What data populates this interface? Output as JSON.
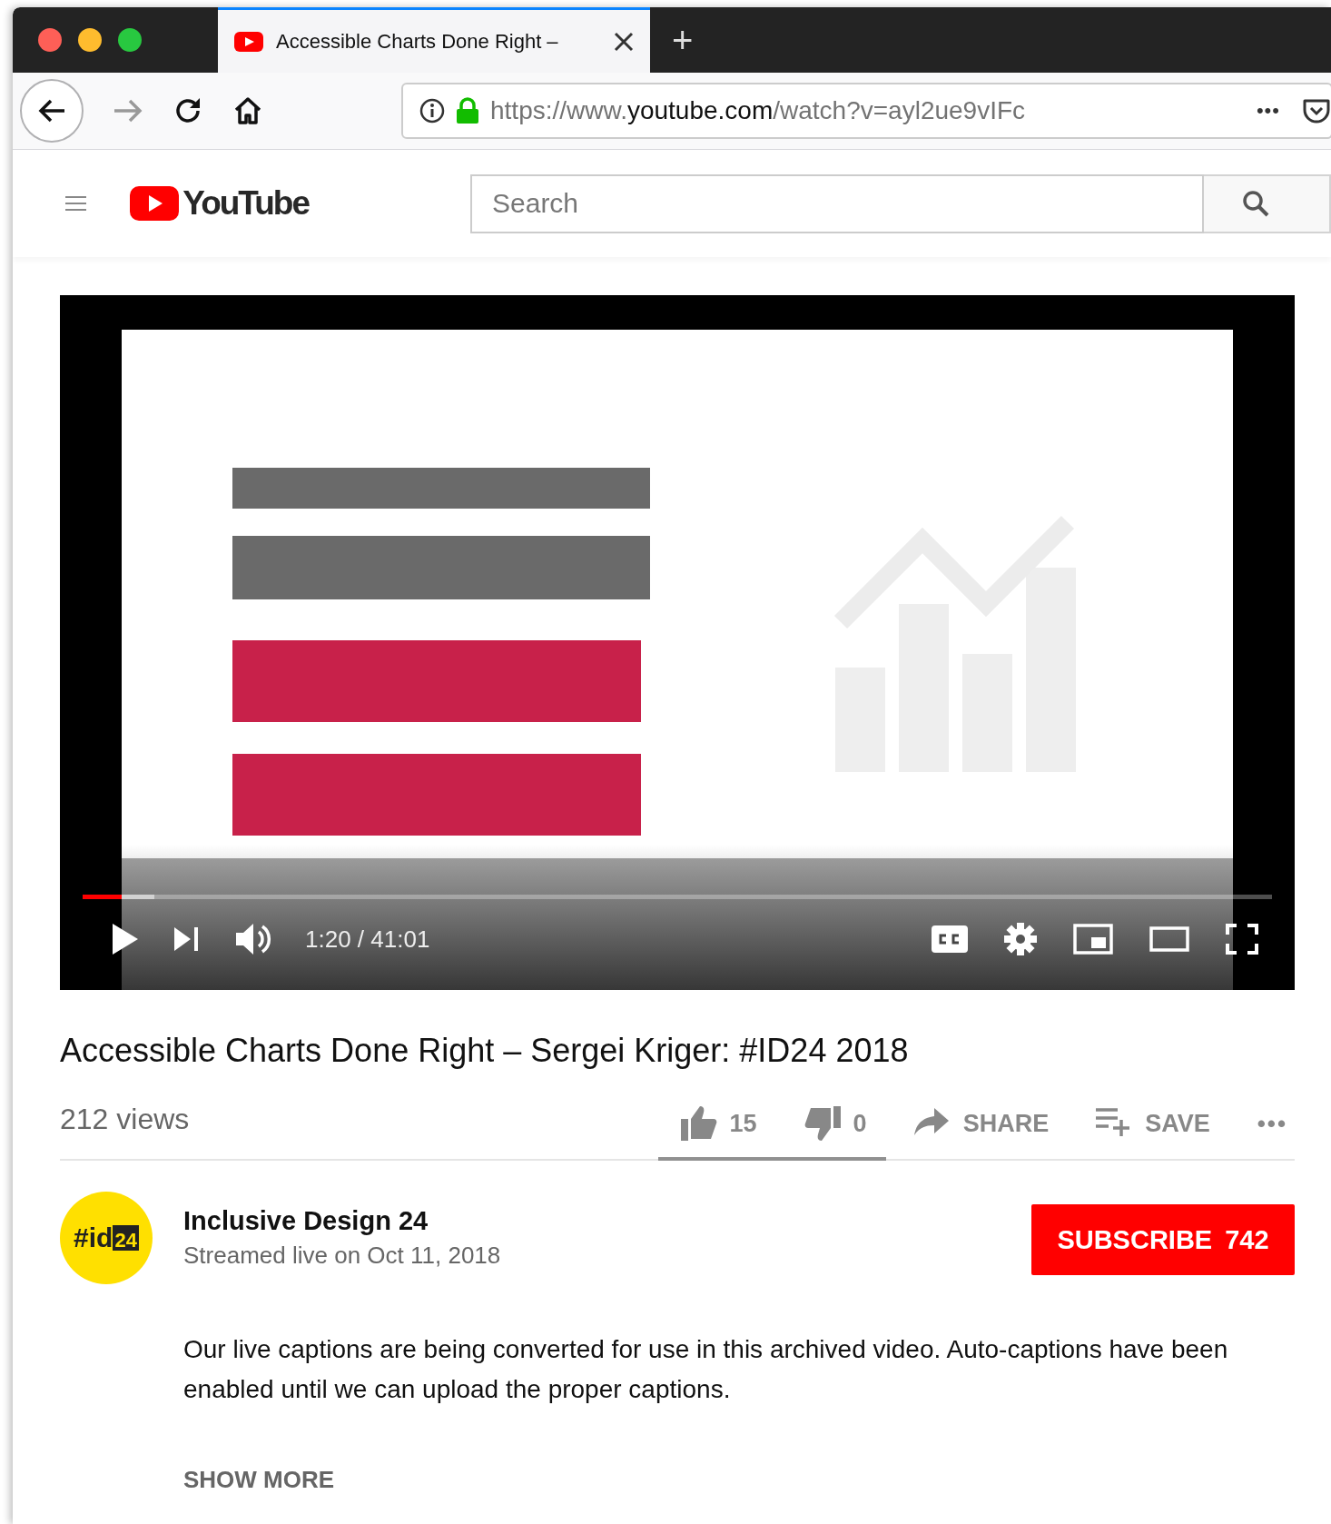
{
  "browser": {
    "tab": {
      "title": "Accessible Charts Done Right –",
      "selected": true
    },
    "new_tab": "+",
    "url": {
      "scheme": "https://www.",
      "domain": "youtube.com",
      "path": "/watch?v=ayl2ue9vIFc"
    },
    "menu": "•••"
  },
  "header": {
    "logo": "YouTube",
    "search": {
      "placeholder": "Search"
    }
  },
  "player": {
    "progress": {
      "level": 0.033
    },
    "time": "1:20 / 41:01",
    "playing": false
  },
  "video": {
    "title": "Accessible Charts Done Right – Sergei Kriger: #ID24 2018",
    "views": "212 views",
    "actions": [
      {
        "kind": "like",
        "label": "15"
      },
      {
        "kind": "dislike",
        "label": "0"
      },
      {
        "kind": "share",
        "label": "SHARE"
      },
      {
        "kind": "save",
        "label": "SAVE"
      },
      {
        "kind": "more",
        "label": "•••"
      }
    ],
    "sentiment": {
      "level": 1
    }
  },
  "channel": {
    "avatar": {
      "text": "#id",
      "badge": "24"
    },
    "name": "Inclusive Design 24",
    "date": "Streamed live on Oct 11, 2018",
    "subscribe": "SUBSCRIBE",
    "subscribers": "742"
  },
  "description": "Our live captions are being converted for use in this archived video. Auto-captions have been enabled until we can upload the proper captions.",
  "show_more": "SHOW MORE"
}
